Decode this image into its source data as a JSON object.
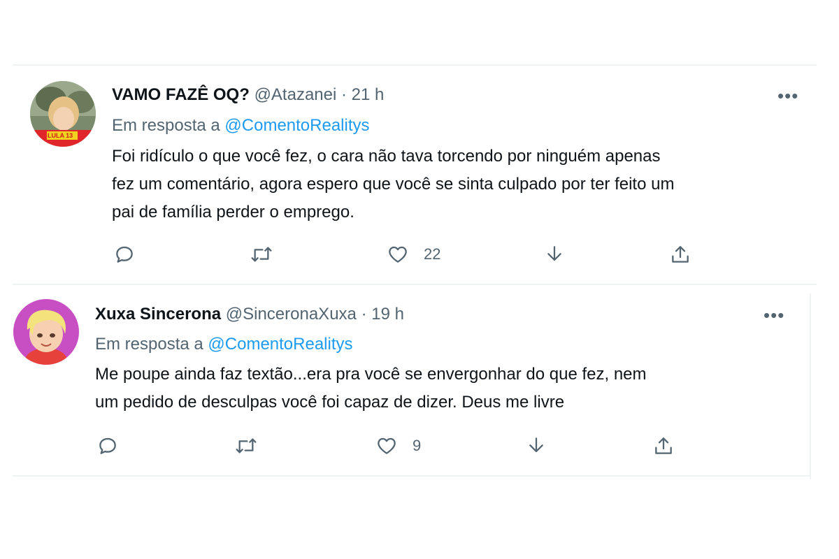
{
  "tweets": [
    {
      "display_name": "VAMO FAZÊ OQ?",
      "handle": "@Atazanei",
      "separator": "·",
      "time": "21 h",
      "reply_prefix": "Em resposta a",
      "reply_mention": "@ComentoRealitys",
      "lines": [
        "Foi ridículo o que você fez, o cara não tava torcendo por ninguém apenas",
        "fez um comentário, agora espero que você se sinta culpado por ter feito um",
        "pai de família perder o emprego."
      ],
      "avatar_badge": "LULA 13",
      "like_count": "22",
      "more_label": "•••"
    },
    {
      "display_name": "Xuxa Sincerona",
      "handle": "@SinceronaXuxa",
      "separator": "·",
      "time": "19 h",
      "reply_prefix": "Em resposta a",
      "reply_mention": "@ComentoRealitys",
      "lines": [
        "Me poupe ainda faz textão...era pra você se envergonhar do que fez, nem",
        "um pedido de desculpas você foi capaz de dizer. Deus me livre"
      ],
      "like_count": "9",
      "more_label": "•••"
    }
  ],
  "icons": [
    "reply-icon",
    "retweet-icon",
    "like-icon",
    "download-icon",
    "share-icon",
    "more-icon"
  ],
  "colors": {
    "accent": "#1d9bf0",
    "secondary_text": "#536471",
    "divider": "#eff3f4"
  }
}
